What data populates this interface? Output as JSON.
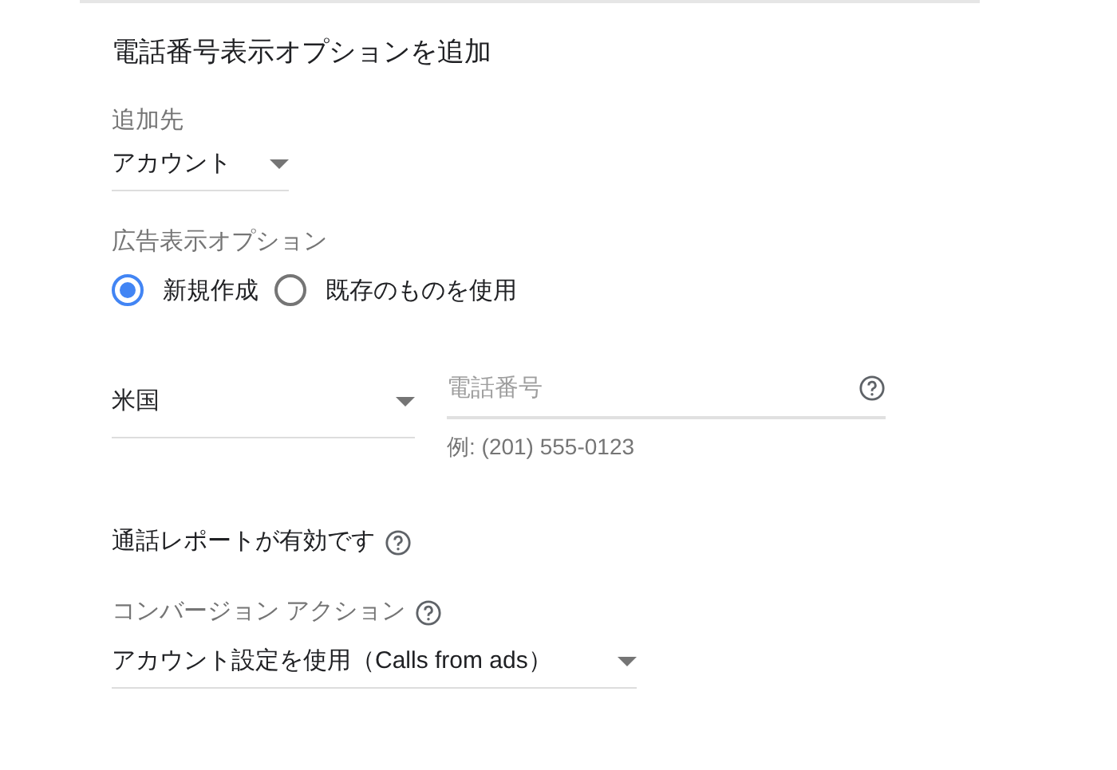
{
  "title": "電話番号表示オプションを追加",
  "add_to": {
    "label": "追加先",
    "value": "アカウント"
  },
  "ad_extension": {
    "label": "広告表示オプション",
    "options": [
      {
        "label": "新規作成",
        "selected": true
      },
      {
        "label": "既存のものを使用",
        "selected": false
      }
    ]
  },
  "country": {
    "value": "米国"
  },
  "phone": {
    "placeholder": "電話番号",
    "hint": "例: (201) 555-0123"
  },
  "call_reporting": {
    "label": "通話レポートが有効です"
  },
  "conversion_action": {
    "label": "コンバージョン アクション",
    "value": "アカウント設定を使用（Calls from ads）"
  }
}
